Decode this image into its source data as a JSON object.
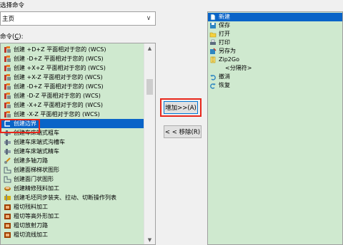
{
  "header": {
    "title": "选择命令",
    "combo_value": "主页",
    "commands_label": "命令",
    "commands_accel": "C"
  },
  "command_list": [
    {
      "label": "创建 +D+Z 平面相对于您的 (WCS)",
      "icon": "mill-plane-icon"
    },
    {
      "label": "创建 -D+Z 平面相对于您的 (WCS)",
      "icon": "mill-plane-icon"
    },
    {
      "label": "创建 +X+Z 平面相对于您的 (WCS)",
      "icon": "mill-plane-icon"
    },
    {
      "label": "创建 +X-Z 平面相对于您的 (WCS)",
      "icon": "mill-plane-icon"
    },
    {
      "label": "创建 -D+Z 平面相对于您的 (WCS)",
      "icon": "mill-plane-icon"
    },
    {
      "label": "创建 -D-Z 平面相对于您的 (WCS)",
      "icon": "mill-plane-icon"
    },
    {
      "label": "创建 -X+Z 平面相对于您的 (WCS)",
      "icon": "mill-plane-icon"
    },
    {
      "label": "创建 -X-Z 平面相对于您的 (WCS)",
      "icon": "mill-plane-icon"
    },
    {
      "label": "创建边界",
      "icon": "boundary-icon",
      "selected": true
    },
    {
      "label": "创建车床端式粗车",
      "icon": "lathe-icon"
    },
    {
      "label": "创建车床端式沟槽车",
      "icon": "lathe-icon"
    },
    {
      "label": "创建车床端式精车",
      "icon": "lathe-icon"
    },
    {
      "label": "创建多轴刀路",
      "icon": "multiaxis-icon"
    },
    {
      "label": "创建面梯梯状图形",
      "icon": "shape-icon"
    },
    {
      "label": "创建面门状图形",
      "icon": "shape-icon"
    },
    {
      "label": "创建精修残料加工",
      "icon": "finish-icon"
    },
    {
      "label": "创建毛坯同步装夹、拉动、切断操作列表",
      "icon": "stock-icon"
    },
    {
      "label": "粗切残料加工",
      "icon": "rough-icon"
    },
    {
      "label": "粗切等高外形加工",
      "icon": "rough-icon"
    },
    {
      "label": "粗切放射刀路",
      "icon": "rough-icon"
    },
    {
      "label": "粗切流线加工",
      "icon": "rough-icon"
    }
  ],
  "buttons": {
    "add": "增加>>(A)",
    "remove": "< < 移除(R)"
  },
  "toolbar_list": [
    {
      "label": "新建",
      "icon": "new-file-icon",
      "selected": true
    },
    {
      "label": "保存",
      "icon": "save-icon"
    },
    {
      "label": "打开",
      "icon": "open-folder-icon"
    },
    {
      "label": "打印",
      "icon": "print-icon"
    },
    {
      "label": "另存为",
      "icon": "save-as-icon"
    },
    {
      "label": "Zip2Go",
      "icon": "zip2go-icon"
    },
    {
      "label": "<分隔符>",
      "icon": "",
      "separator": true
    },
    {
      "label": "撤消",
      "icon": "undo-icon"
    },
    {
      "label": "恢复",
      "icon": "redo-icon"
    }
  ],
  "colors": {
    "list_bg": "#cfe9cf",
    "selection": "#0a64c8",
    "highlight_box": "#e8261b"
  }
}
